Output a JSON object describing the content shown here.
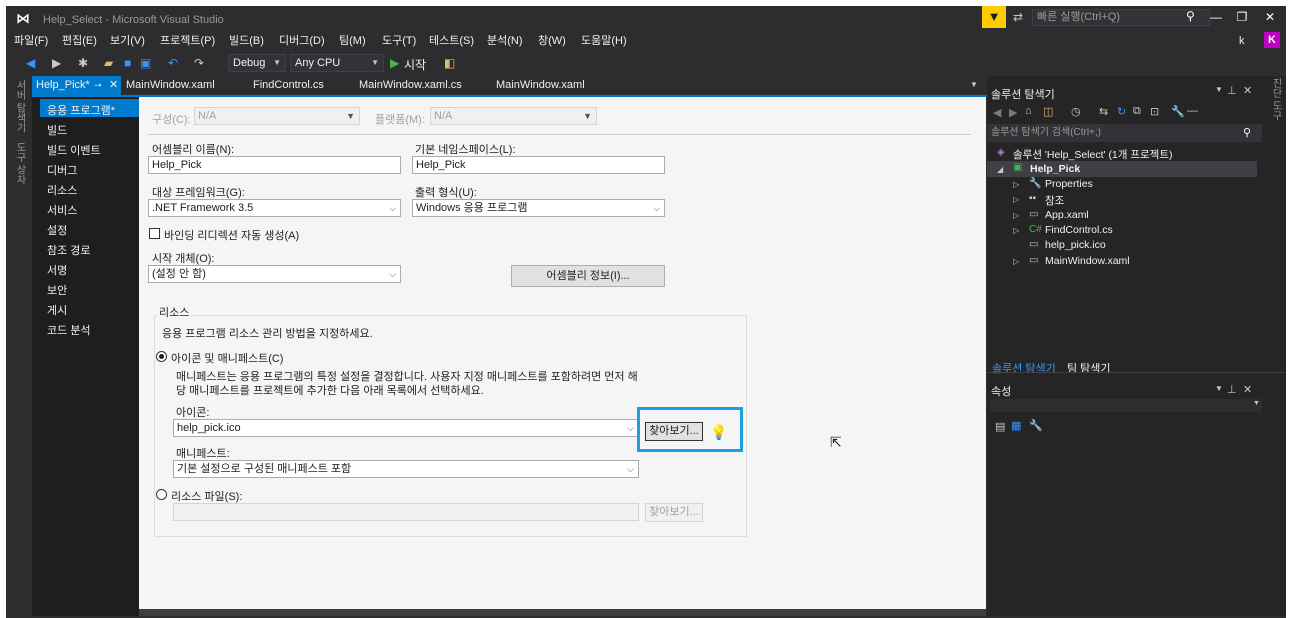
{
  "window": {
    "title": "Help_Select - Microsoft Visual Studio",
    "quick_launch_placeholder": "빠른 실행(Ctrl+Q)",
    "user_initial": "k",
    "avatar_letter": "K"
  },
  "menu": [
    "파일(F)",
    "편집(E)",
    "보기(V)",
    "프로젝트(P)",
    "빌드(B)",
    "디버그(D)",
    "팀(M)",
    "도구(T)",
    "테스트(S)",
    "분석(N)",
    "창(W)",
    "도움말(H)"
  ],
  "toolbar": {
    "config": "Debug",
    "platform": "Any CPU",
    "start_label": "시작"
  },
  "left_strip": [
    "서버 탐색기",
    "도구 상자"
  ],
  "doc_tabs": {
    "active": "Help_Pick*",
    "others": [
      "MainWindow.xaml",
      "FindControl.cs",
      "MainWindow.xaml.cs",
      "MainWindow.xaml"
    ]
  },
  "props_nav": [
    "응용 프로그램*",
    "빌드",
    "빌드 이벤트",
    "디버그",
    "리소스",
    "서비스",
    "설정",
    "참조 경로",
    "서명",
    "보안",
    "게시",
    "코드 분석"
  ],
  "props": {
    "config_label": "구성(C):",
    "config_value": "N/A",
    "platform_label": "플랫폼(M):",
    "platform_value": "N/A",
    "assembly_name_label": "어셈블리 이름(N):",
    "assembly_name": "Help_Pick",
    "default_ns_label": "기본 네임스페이스(L):",
    "default_ns": "Help_Pick",
    "target_fw_label": "대상 프레임워크(G):",
    "target_fw": ".NET Framework 3.5",
    "output_type_label": "출력 형식(U):",
    "output_type": "Windows 응용 프로그램",
    "auto_binding_label": "바인딩 리디렉션 자동 생성(A)",
    "startup_label": "시작 개체(O):",
    "startup_value": "(설정 안 함)",
    "assembly_info_button": "어셈블리 정보(I)...",
    "resources_header": "리소스",
    "resources_desc": "응용 프로그램 리소스 관리 방법을 지정하세요.",
    "icon_manifest_radio": "아이콘 및 매니페스트(C)",
    "manifest_desc_1": "매니페스트는 응용 프로그램의 특정 설정을 결정합니다. 사용자 지정 매니페스트를 포함하려면 먼저 해",
    "manifest_desc_2": "당 매니페스트를 프로젝트에 추가한 다음 아래 목록에서 선택하세요.",
    "icon_label": "아이콘:",
    "icon_value": "help_pick.ico",
    "browse_button": "찾아보기...",
    "manifest_label": "매니페스트:",
    "manifest_value": "기본 설정으로 구성된 매니페스트 포함",
    "resource_file_radio": "리소스 파일(S):",
    "resource_browse_button": "찾아보기..."
  },
  "solution_explorer": {
    "title": "솔루션 탐색기",
    "search_placeholder": "솔루션 탐색기 검색(Ctrl+;)",
    "solution_node": "솔루션 'Help_Select' (1개 프로젝트)",
    "project_node": "Help_Pick",
    "items": [
      "Properties",
      "참조",
      "App.xaml",
      "FindControl.cs",
      "help_pick.ico",
      "MainWindow.xaml"
    ],
    "bottom_tabs": [
      "솔루션 탐색기",
      "팀 탐색기"
    ]
  },
  "properties_panel": {
    "title": "속성"
  },
  "right_strip": [
    "진단 도구"
  ],
  "colors": {
    "accent": "#007acc",
    "highlight": "#1ba1e2",
    "chrome": "#2d2d30"
  }
}
